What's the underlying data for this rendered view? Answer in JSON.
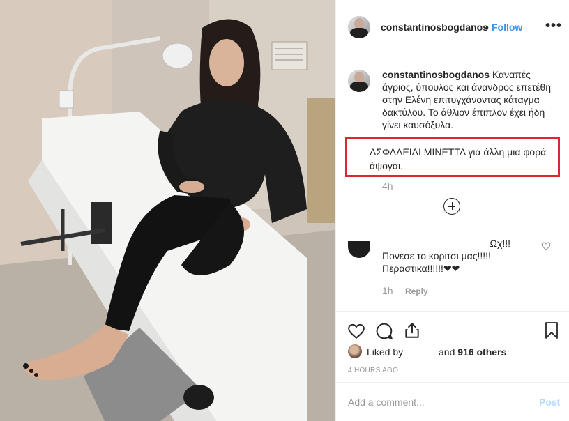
{
  "post": {
    "username": "constantinosbogdanos",
    "dot": "•",
    "follow_label": "Follow",
    "more_icon": "more-options-icon",
    "more_text": "•••"
  },
  "caption": {
    "username": "constantinosbogdanos",
    "text": "Καναπές άγριος, ύπουλος και άνανδρος επετέθη στην Ελένη επιτυγχάνοντας κάταγμα δακτύλου. Το άθλιον έπιπλον έχει ήδη γίνει καυσόξυλα.",
    "highlight_text": "ΑΣΦΑΛΕΙΑΙ ΜΙΝΕΤΤΑ για άλλη μια φορά άψογαι.",
    "time": "4h",
    "highlight_color": "#d9282f"
  },
  "comments": [
    {
      "line1": "Ωχ!!!",
      "line2": "Πονεσε το κοριτσι μας!!!!!",
      "line3": "Περαστικα!!!!!!❤❤",
      "time": "1h",
      "reply_label": "Reply"
    }
  ],
  "actions": {
    "like_icon": "heart-icon",
    "comment_icon": "comment-icon",
    "share_icon": "share-icon",
    "save_icon": "bookmark-icon"
  },
  "likes": {
    "liked_by": "Liked by",
    "and": "and",
    "count": "916 others"
  },
  "timestamp": "4 HOURS AGO",
  "add_comment": {
    "placeholder": "Add a comment...",
    "post_label": "Post"
  },
  "colors": {
    "link": "#3897f0",
    "muted": "#999999",
    "text": "#262626",
    "post_disabled": "#b3dbff"
  }
}
